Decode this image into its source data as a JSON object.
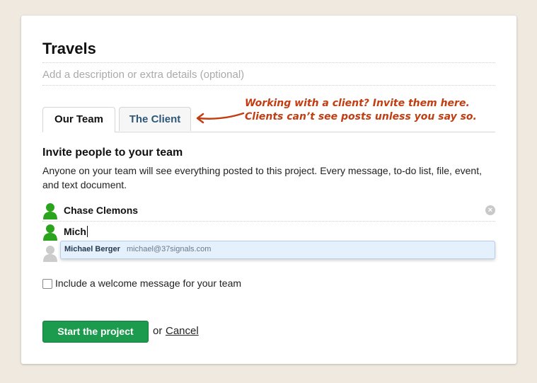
{
  "project": {
    "title": "Travels",
    "description_placeholder": "Add a description or extra details (optional)"
  },
  "tabs": [
    {
      "label": "Our Team",
      "active": true
    },
    {
      "label": "The Client",
      "active": false
    }
  ],
  "client_note": {
    "line1": "Working with a client? Invite them here.",
    "line2": "Clients can’t see posts unless you say so."
  },
  "invite": {
    "heading": "Invite people to your team",
    "description": "Anyone on your team will see everything posted to this project. Every message, to-do list, file, event, and text document.",
    "people": [
      {
        "name": "Chase Clemons"
      }
    ],
    "input_value": "Mich",
    "suggestion": {
      "name": "Michael Berger",
      "email": "michael@37signals.com"
    }
  },
  "welcome": {
    "checked": false,
    "label": "Include a welcome message for your team"
  },
  "actions": {
    "start_label": "Start the project",
    "or_text": "or",
    "cancel_label": "Cancel"
  },
  "colors": {
    "background": "#efe9df",
    "accent_green": "#1c9b4e",
    "note_red": "#c23d11",
    "avatar_green": "#2aa41c",
    "avatar_gray": "#cccccc",
    "tab_link": "#2d5777"
  }
}
